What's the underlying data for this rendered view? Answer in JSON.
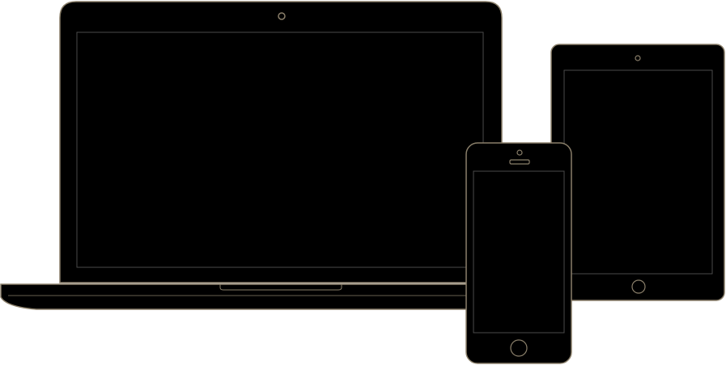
{
  "scene": {
    "devices": [
      "laptop",
      "tablet",
      "phone"
    ]
  },
  "colors": {
    "device_fill": "#000000",
    "outline": "#8a7f6a",
    "screen_outline": "#4a4a4a",
    "background": "#ffffff"
  }
}
